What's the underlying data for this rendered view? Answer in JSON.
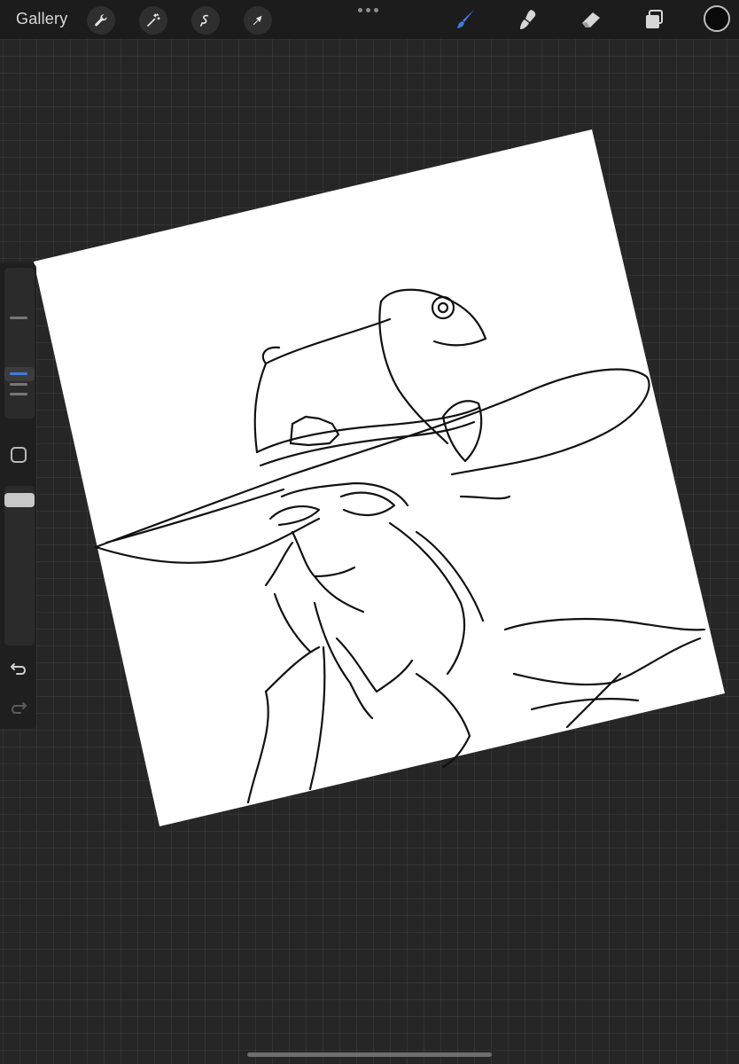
{
  "toolbar": {
    "gallery_label": "Gallery",
    "left_tools": [
      {
        "icon": "wrench-icon"
      },
      {
        "icon": "magic-wand-icon"
      },
      {
        "icon": "selection-icon"
      },
      {
        "icon": "transform-arrow-icon"
      }
    ],
    "right_tools": [
      {
        "icon": "brush-icon",
        "active": true
      },
      {
        "icon": "smudge-icon"
      },
      {
        "icon": "eraser-icon"
      },
      {
        "icon": "layers-icon"
      }
    ],
    "current_color": "#0a0a0a"
  },
  "colors": {
    "accent": "#3f7be0",
    "topbar": "#1c1c1c",
    "background": "#262626"
  },
  "sidebar": {
    "brush_size_icon": "brush-size-slider",
    "opacity_icon": "opacity-slider",
    "modify_icon": "square-modify-icon",
    "undo_icon": "undo-icon",
    "redo_icon": "redo-icon"
  },
  "canvas": {
    "artwork": "line-art-sketch"
  }
}
